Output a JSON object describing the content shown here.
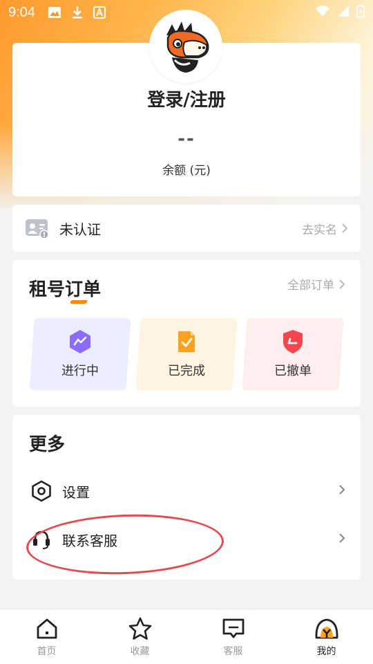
{
  "status_bar": {
    "time": "9:04",
    "icons": [
      "image-icon",
      "download-icon",
      "text-badge-icon"
    ],
    "right_icons": [
      "wifi-icon",
      "signal-icon",
      "battery-charging-icon"
    ]
  },
  "profile": {
    "login_label": "登录/注册",
    "balance_value": "--",
    "balance_label": "余额 (元)"
  },
  "verification": {
    "status_label": "未认证",
    "action_label": "去实名"
  },
  "orders": {
    "title": "租号订单",
    "all_link": "全部订单",
    "tiles": [
      {
        "label": "进行中",
        "icon": "in-progress-icon",
        "color": "#8b6cff"
      },
      {
        "label": "已完成",
        "icon": "completed-icon",
        "color": "#ffa21f"
      },
      {
        "label": "已撤单",
        "icon": "cancelled-icon",
        "color": "#f5454e"
      }
    ]
  },
  "more": {
    "title": "更多",
    "items": [
      {
        "label": "设置",
        "icon": "settings-hex-icon"
      },
      {
        "label": "联系客服",
        "icon": "headset-icon"
      }
    ]
  },
  "tabbar": {
    "tabs": [
      {
        "label": "首页",
        "icon": "home-icon"
      },
      {
        "label": "收藏",
        "icon": "star-icon"
      },
      {
        "label": "客服",
        "icon": "chat-icon"
      },
      {
        "label": "我的",
        "icon": "profile-helmet-icon",
        "active": true
      }
    ]
  },
  "colors": {
    "accent_orange": "#ff8a00",
    "annotation_red": "#e8494f",
    "muted_text": "#aaaaaa"
  }
}
